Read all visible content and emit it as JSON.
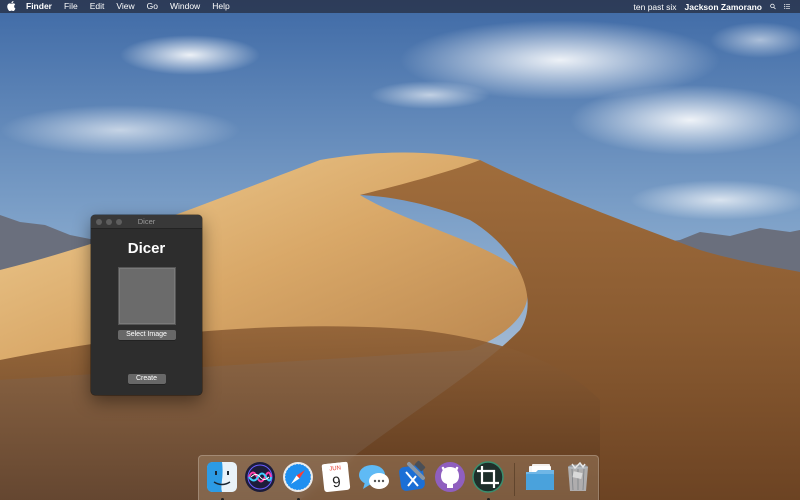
{
  "menubar": {
    "apple_icon": "apple-icon",
    "app_name": "Finder",
    "menus": [
      "File",
      "Edit",
      "View",
      "Go",
      "Window",
      "Help"
    ],
    "clock": "ten past six",
    "user": "Jackson Zamorano",
    "right_icons": [
      "spotlight-search-icon",
      "notification-center-icon"
    ]
  },
  "window": {
    "title": "Dicer",
    "heading": "Dicer",
    "select_button": "Select Image",
    "create_button": "Create"
  },
  "dock": {
    "items": [
      {
        "name": "Finder",
        "icon": "finder-icon",
        "running": true
      },
      {
        "name": "Siri",
        "icon": "siri-icon",
        "running": false
      },
      {
        "name": "Safari",
        "icon": "safari-icon",
        "running": true
      },
      {
        "name": "Calendar",
        "icon": "calendar-icon",
        "running": false,
        "month": "JUN",
        "day": "9"
      },
      {
        "name": "Messages",
        "icon": "messages-icon",
        "running": false
      },
      {
        "name": "Xcode",
        "icon": "xcode-icon",
        "running": false
      },
      {
        "name": "GitHub Desktop",
        "icon": "github-icon",
        "running": false
      },
      {
        "name": "Dicer",
        "icon": "crop-icon",
        "running": true
      },
      {
        "name": "Applications Folder",
        "icon": "folder-icon",
        "running": false
      },
      {
        "name": "Trash",
        "icon": "trash-icon",
        "running": false
      }
    ]
  },
  "colors": {
    "window_background": "#2d2d2d",
    "button_background": "#686868",
    "menubar_background": "#283044"
  }
}
